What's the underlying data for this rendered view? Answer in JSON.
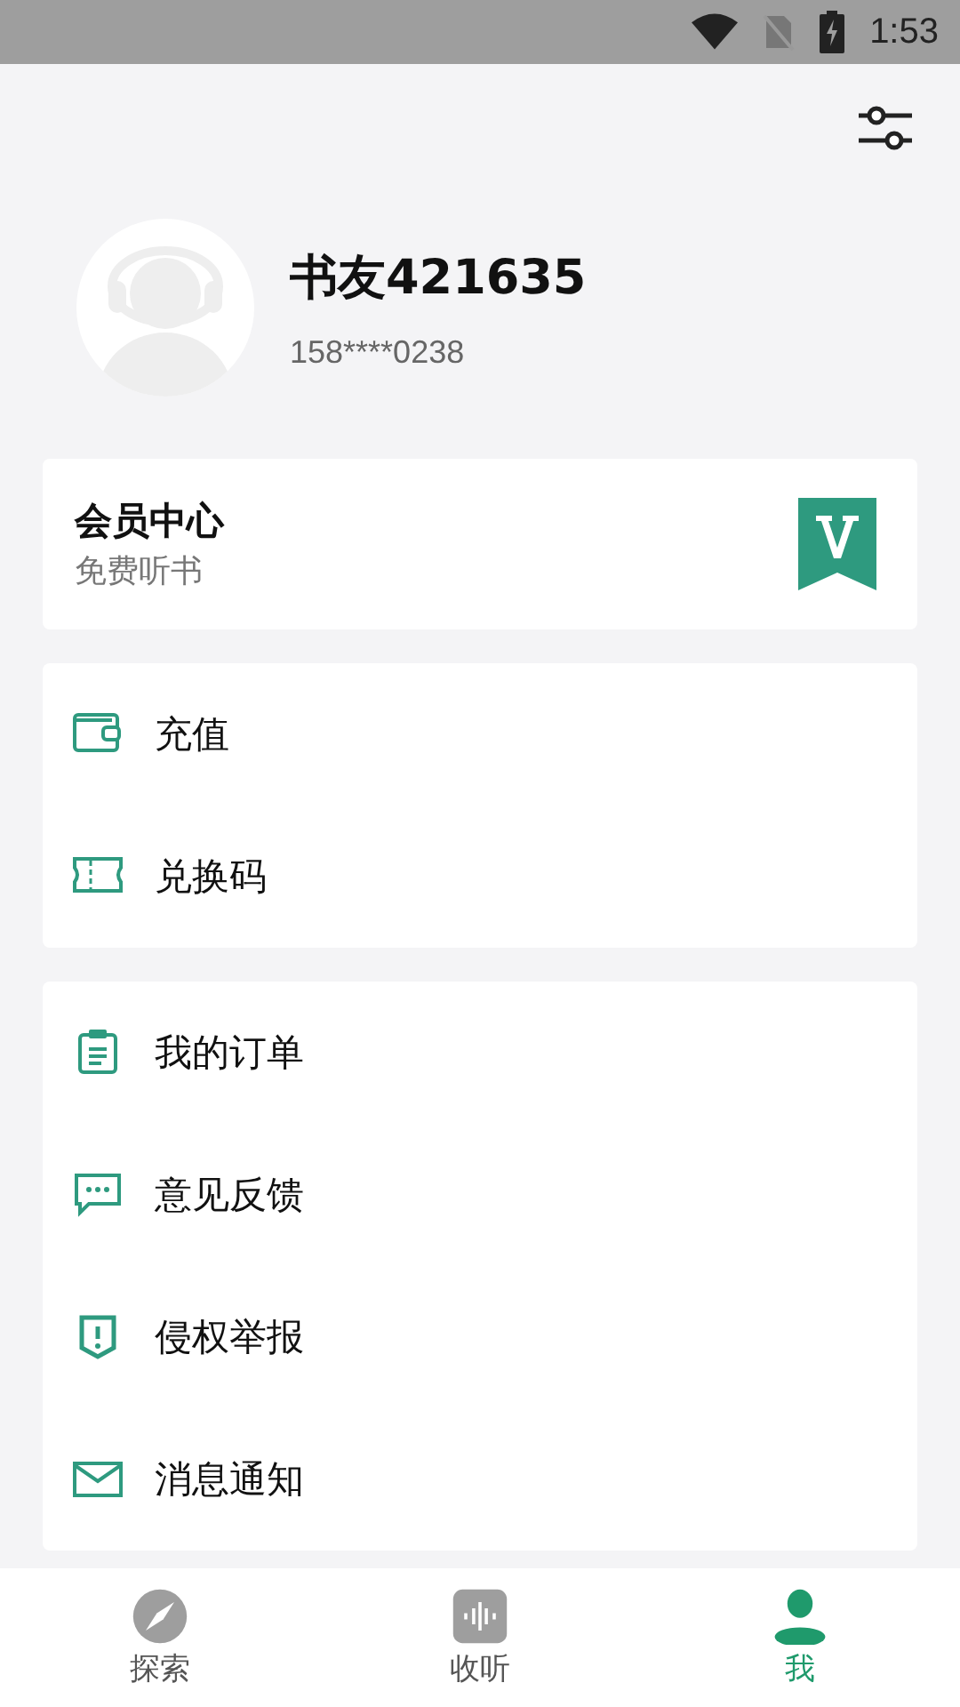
{
  "status_bar": {
    "time": "1:53"
  },
  "profile": {
    "name": "书友421635",
    "phone": "158****0238"
  },
  "member_card": {
    "title": "会员中心",
    "subtitle": "免费听书"
  },
  "menu_groups": [
    {
      "items": [
        {
          "kind": "wallet",
          "label": "充值"
        },
        {
          "kind": "ticket",
          "label": "兑换码"
        }
      ]
    },
    {
      "items": [
        {
          "kind": "clipboard",
          "label": "我的订单"
        },
        {
          "kind": "chat",
          "label": "意见反馈"
        },
        {
          "kind": "shield",
          "label": "侵权举报"
        },
        {
          "kind": "mail",
          "label": "消息通知"
        }
      ]
    }
  ],
  "tabs": [
    {
      "kind": "compass",
      "label": "探索",
      "selected": false
    },
    {
      "kind": "audio",
      "label": "收听",
      "selected": false
    },
    {
      "kind": "person",
      "label": "我",
      "selected": true
    }
  ]
}
